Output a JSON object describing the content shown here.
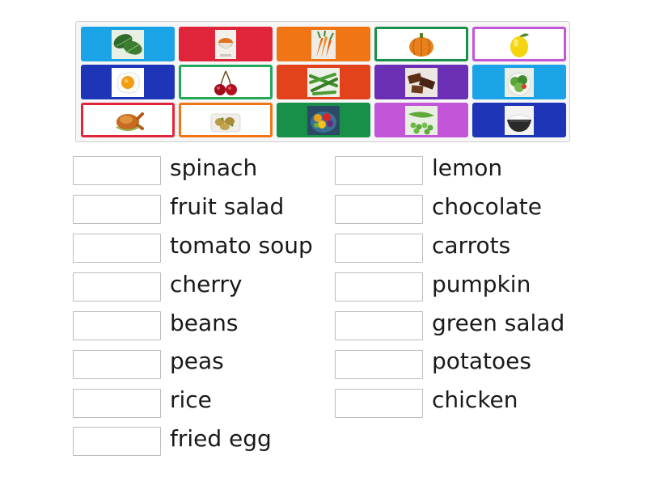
{
  "tiles": [
    {
      "picture": "spinach-leaves",
      "style": "filled",
      "color": "#1aa3e6"
    },
    {
      "picture": "soup-bowl",
      "style": "filled",
      "color": "#e0243a"
    },
    {
      "picture": "carrots",
      "style": "filled",
      "color": "#f07515"
    },
    {
      "picture": "pumpkin",
      "style": "outlined",
      "color": "#19904a"
    },
    {
      "picture": "lemon",
      "style": "outlined",
      "color": "#c355d9"
    },
    {
      "picture": "fried-egg",
      "style": "filled",
      "color": "#1f35b8"
    },
    {
      "picture": "cherries",
      "style": "outlined",
      "color": "#22a85a"
    },
    {
      "picture": "green-beans",
      "style": "filled",
      "color": "#e2431b"
    },
    {
      "picture": "chocolate",
      "style": "filled",
      "color": "#6a2fb5"
    },
    {
      "picture": "green-salad",
      "style": "filled",
      "color": "#1aa3e6"
    },
    {
      "picture": "roast-chicken",
      "style": "outlined",
      "color": "#e0243a"
    },
    {
      "picture": "potatoes",
      "style": "outlined",
      "color": "#f07515"
    },
    {
      "picture": "fruit-salad",
      "style": "filled",
      "color": "#19904a"
    },
    {
      "picture": "peas",
      "style": "filled",
      "color": "#c355d9"
    },
    {
      "picture": "rice",
      "style": "filled",
      "color": "#1f35b8"
    }
  ],
  "words_left": [
    "spinach",
    "fruit salad",
    "tomato soup",
    "cherry",
    "beans",
    "peas",
    "rice",
    "fried egg"
  ],
  "words_right": [
    "lemon",
    "chocolate",
    "carrots",
    "pumpkin",
    "green salad",
    "potatoes",
    "chicken"
  ]
}
